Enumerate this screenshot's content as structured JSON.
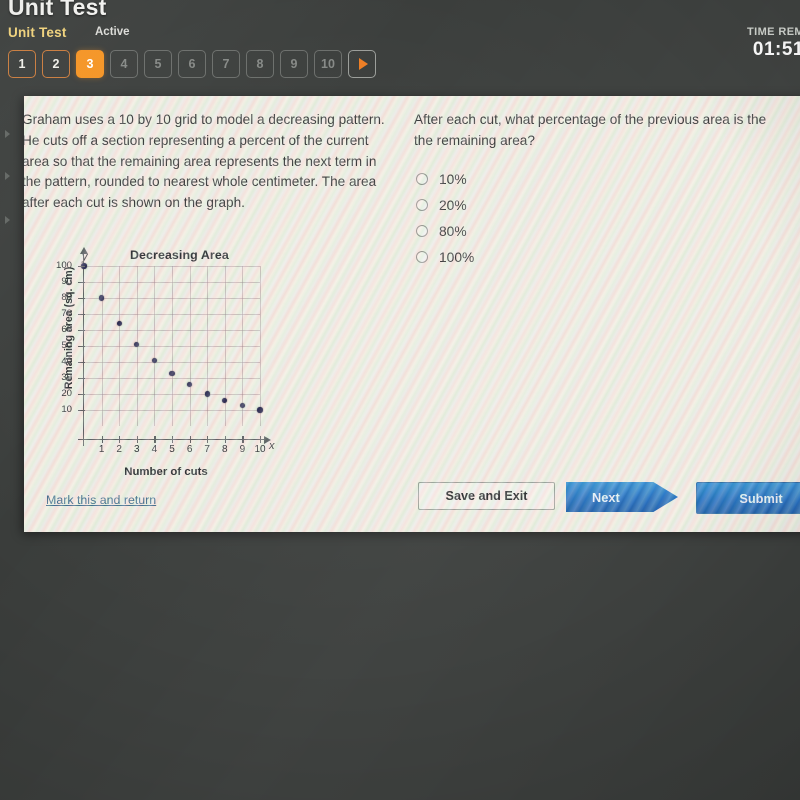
{
  "header": {
    "app_title": "Unit Test",
    "breadcrumb": "Unit Test",
    "status": "Active",
    "timer_label": "TIME REM",
    "timer_value": "01:51"
  },
  "pager": {
    "items": [
      {
        "label": "1",
        "state": "done"
      },
      {
        "label": "2",
        "state": "done"
      },
      {
        "label": "3",
        "state": "active"
      },
      {
        "label": "4",
        "state": "todo"
      },
      {
        "label": "5",
        "state": "todo"
      },
      {
        "label": "6",
        "state": "todo"
      },
      {
        "label": "7",
        "state": "todo"
      },
      {
        "label": "8",
        "state": "todo"
      },
      {
        "label": "9",
        "state": "todo"
      },
      {
        "label": "10",
        "state": "todo"
      }
    ],
    "next_arrow": "next-arrow-icon"
  },
  "question": {
    "body": "Graham uses a 10 by 10 grid to model a decreasing pattern. He cuts off a section representing a percent of the current area so that the remaining area represents the next term in the pattern, rounded to nearest whole centimeter. The area after each cut is shown on the graph.",
    "prompt": "After each cut, what percentage of the previous area is the the remaining area?",
    "choices": [
      {
        "label": "10%",
        "selected": false
      },
      {
        "label": "20%",
        "selected": false
      },
      {
        "label": "80%",
        "selected": false
      },
      {
        "label": "100%",
        "selected": false
      }
    ]
  },
  "chart_data": {
    "type": "scatter",
    "title": "Decreasing Area",
    "xlabel": "Number of cuts",
    "ylabel": "Remaining area (sq. cm)",
    "x_axis_symbol": "x",
    "y_axis_symbol": "y",
    "x": [
      0,
      1,
      2,
      3,
      4,
      5,
      6,
      7,
      8,
      9,
      10
    ],
    "values": [
      100,
      80,
      64,
      51,
      41,
      33,
      26,
      20,
      16,
      13,
      10
    ],
    "xticks": [
      1,
      2,
      3,
      4,
      5,
      6,
      7,
      8,
      9,
      10
    ],
    "yticks": [
      10,
      20,
      30,
      40,
      50,
      60,
      70,
      80,
      90,
      100
    ],
    "xlim": [
      0,
      10
    ],
    "ylim": [
      0,
      100
    ],
    "grid": true,
    "legend": false,
    "point_color": "#20204a"
  },
  "footer": {
    "mark_link": "Mark this and return",
    "save_label": "Save and Exit",
    "next_label": "Next",
    "submit_label": "Submit"
  },
  "colors": {
    "accent_orange": "#f59322",
    "brand_yellow": "#f0d27a",
    "button_blue": "#1f6fc2",
    "link_blue": "#3d6c8e",
    "desktop": "#3a3d3b"
  }
}
